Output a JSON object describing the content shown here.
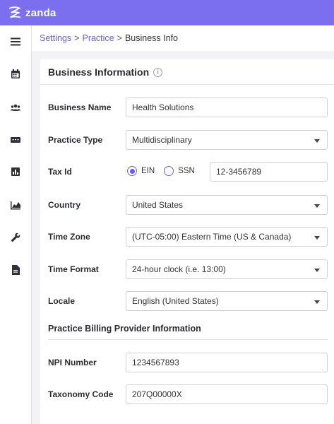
{
  "app": {
    "brand": "zanda",
    "accent": "#7b6ff0"
  },
  "sidebar": {
    "icons": [
      "menu-icon",
      "calendar-icon",
      "people-icon",
      "sms-icon",
      "bar-chart-icon",
      "area-chart-icon",
      "wrench-icon",
      "document-icon"
    ]
  },
  "breadcrumb": {
    "settings": "Settings",
    "practice": "Practice",
    "current": "Business Info",
    "sep": ">"
  },
  "card": {
    "title": "Business Information"
  },
  "form": {
    "business_name": {
      "label": "Business Name",
      "value": "Health Solutions"
    },
    "practice_type": {
      "label": "Practice Type",
      "value": "Multidisciplinary"
    },
    "tax_id": {
      "label": "Tax Id",
      "opt1": "EIN",
      "opt2": "SSN",
      "selected": "EIN",
      "value": "12-3456789"
    },
    "country": {
      "label": "Country",
      "value": "United States"
    },
    "time_zone": {
      "label": "Time Zone",
      "value": "(UTC-05:00) Eastern Time (US & Canada)"
    },
    "time_format": {
      "label": "Time Format",
      "value": "24-hour clock (i.e. 13:00)"
    },
    "locale": {
      "label": "Locale",
      "value": "English (United States)"
    }
  },
  "billing": {
    "title": "Practice Billing Provider Information",
    "npi": {
      "label": "NPI Number",
      "value": "1234567893"
    },
    "taxonomy": {
      "label": "Taxonomy Code",
      "value": "207Q00000X"
    }
  }
}
